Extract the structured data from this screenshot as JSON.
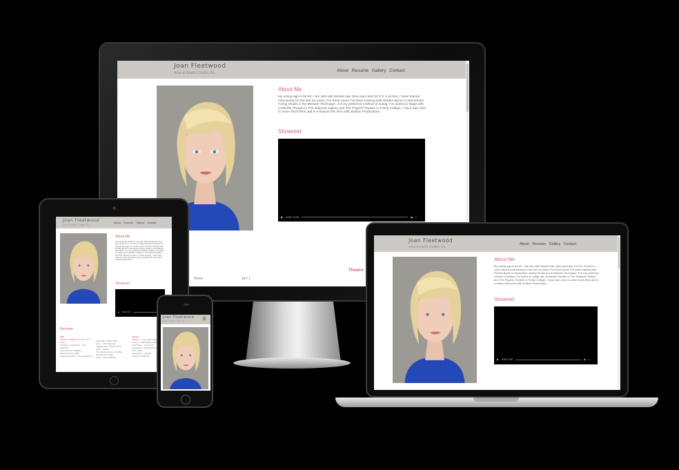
{
  "site": {
    "name": "Joan Fleetwood",
    "tagline": "Actor & Model | Dublin, IRL",
    "nav": [
      "About",
      "Resume",
      "Gallery",
      "Contact"
    ],
    "about_heading": "About Me",
    "bio": "My acting age is 55-63. I am slim with blonde hair, blue eyes and I'm 5 ft. 5 inches. I have trained extensively for the last six years. For three years I've been training with Robbie Byrne in Momentum Acting Studio in the Meisner Technique. It is my preferred method of acting. I've acted on stage with Umbrella Theatre in The National Gallery and The Players Theatre in Trinity College. I have had roles in some short films and in a feature film shot with Zenbar Productions.",
    "showreel_heading": "Showreel",
    "video_time": "0:00 / 0:00",
    "resume_heading": "Resume",
    "film_heading": "Film",
    "theatre_heading": "Theatre",
    "monitor_theatre_label": "Theatre",
    "film_items": [
      "'Bitterdil' | BigBay Entertainment | 2020",
      "'The Final Act' | BigBay Entertainment | 2020"
    ],
    "film_roles": [
      "Producer / Lead Actor – The Matriarch",
      "Supporting Actor – Nosy Neighbour"
    ],
    "short_items": [
      "'Give Bite' | IADT | 2017",
      "'Lateral Point' | IADT | 2019",
      "'The Gentle Curve' | Zenitbar Productions | 2018"
    ],
    "short_roles": [
      "Actor – Nan Bagnoise",
      "Actor – Mother",
      "Actor – Annie Daniels"
    ],
    "theatre_items": [
      "'Grange – I can still be Discovery Tommy' | Nighthawks | 2020",
      "'Confession' | Wild Bird Productions | 2017, 2018",
      "'Cousin Unhide Me'"
    ],
    "theatre_roles": [
      "Lead Actor – Lisa Curtis",
      "Lead Actor – Heather"
    ],
    "monitor_nav_peek": "Home",
    "monitor_misc_peek": "bk / t"
  }
}
